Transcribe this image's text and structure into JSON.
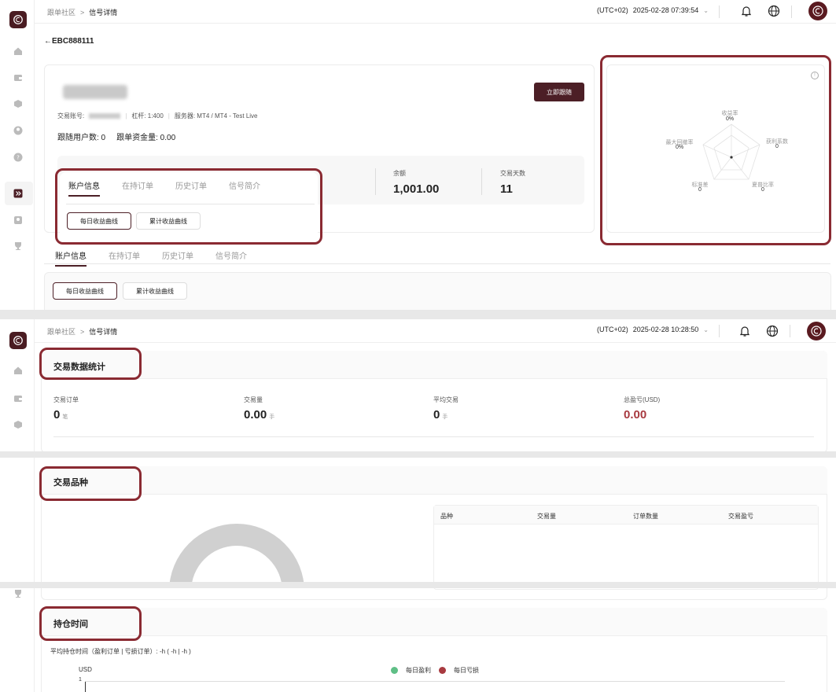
{
  "breadcrumb": {
    "root": "跟单社区",
    "separator": ">",
    "current": "信号详情"
  },
  "topbar_top": {
    "timezone": "(UTC+02)",
    "datetime": "2025-02-28 07:39:54"
  },
  "topbar_bottom": {
    "timezone": "(UTC+02)",
    "datetime": "2025-02-28 10:28:50"
  },
  "back_link": "←EBC888111",
  "signal": {
    "account_label": "交易账号:",
    "leverage": "杠杆: 1:400",
    "server": "服务器: MT4 / MT4 - Test Live",
    "followers": "跟随用户数: 0",
    "follow_funds": "跟单资金量: 0.00",
    "follow_button": "立即跟随",
    "balance_label": "余额",
    "balance_value": "1,001.00",
    "days_label": "交易天数",
    "days_value": "11"
  },
  "tabs": [
    "账户信息",
    "在持订单",
    "历史订单",
    "信号简介"
  ],
  "curve_buttons": [
    "每日收益曲线",
    "累计收益曲线"
  ],
  "radar": {
    "axes": [
      {
        "label": "收益率",
        "value": "0%"
      },
      {
        "label": "获利系数",
        "value": "0"
      },
      {
        "label": "夏普比率",
        "value": "0"
      },
      {
        "label": "标准差",
        "value": "0"
      },
      {
        "label": "最大回撤率",
        "value": "0%"
      }
    ]
  },
  "trade_stats": {
    "title": "交易数据统计",
    "items": [
      {
        "label": "交易订单",
        "value": "0",
        "unit": "笔"
      },
      {
        "label": "交易量",
        "value": "0.00",
        "unit": "手"
      },
      {
        "label": "平均交易",
        "value": "0",
        "unit": "手"
      },
      {
        "label": "总盈亏(USD)",
        "value": "0.00",
        "unit": ""
      }
    ]
  },
  "symbols": {
    "title": "交易品种",
    "columns": [
      "品种",
      "交易量",
      "订单数量",
      "交易盈亏"
    ]
  },
  "holding": {
    "title": "持仓时间",
    "subtitle": "平均持仓时间（盈利订单 | 亏损订单）: -h ( -h | -h )",
    "y_unit": "USD",
    "y_tick": "1",
    "legend": [
      {
        "name": "每日盈利",
        "color": "#5fbf86"
      },
      {
        "name": "每日亏损",
        "color": "#a83a40"
      }
    ]
  },
  "colors": {
    "brand": "#4c1f26",
    "highlight": "#8a2a32",
    "loss": "#a83a40",
    "profit": "#5fbf86"
  }
}
